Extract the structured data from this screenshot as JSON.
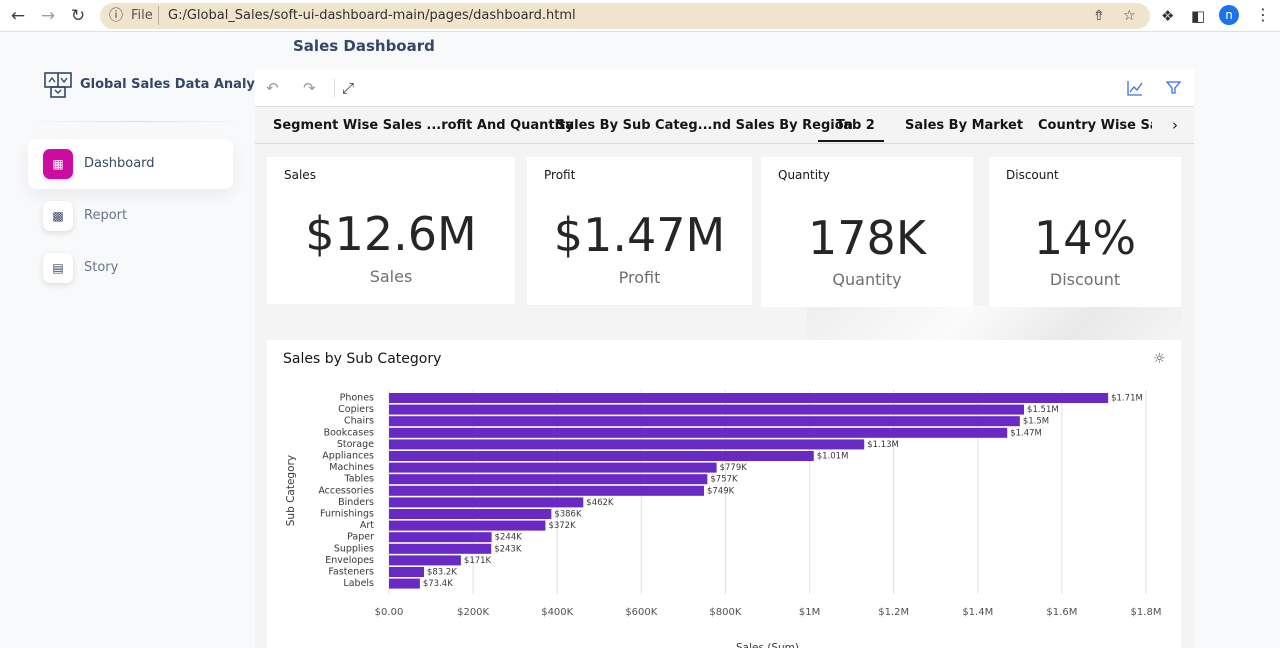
{
  "browser": {
    "back_icon": "arrow-left-icon",
    "forward_icon": "arrow-right-icon",
    "reload_icon": "reload-icon",
    "info_icon": "info-icon",
    "scheme_label": "File",
    "url": "G:/Global_Sales/soft-ui-dashboard-main/pages/dashboard.html",
    "share_icon": "share-icon",
    "bookmark_icon": "star-icon",
    "extensions_icon": "puzzle-icon",
    "sidepanel_icon": "side-panel-icon",
    "profile_initial": "n",
    "menu_icon": "kebab-menu-icon"
  },
  "page": {
    "title": "Sales Dashboard"
  },
  "sidebar": {
    "brand": "Global Sales Data Analytics",
    "items": [
      {
        "label": "Dashboard",
        "icon": "shop-icon",
        "active": true
      },
      {
        "label": "Report",
        "icon": "bar-chart-icon",
        "active": false
      },
      {
        "label": "Story",
        "icon": "card-icon",
        "active": false
      }
    ]
  },
  "toolbar": {
    "undo_icon": "undo-icon",
    "redo_icon": "redo-icon",
    "fullscreen_icon": "expand-icon",
    "chart_icon": "line-chart-icon",
    "filter_icon": "filter-icon"
  },
  "tabs": [
    {
      "label": "Segment Wise Sales ...rofit And Quantity",
      "active": false
    },
    {
      "label": "Sales By Sub Categ...nd Sales By Region",
      "active": false
    },
    {
      "label": "Tab 2",
      "active": true
    },
    {
      "label": "Sales By Market",
      "active": false
    },
    {
      "label": "Country Wise Sales U",
      "active": false
    }
  ],
  "kpis": [
    {
      "label": "Sales",
      "value": "$12.6M",
      "caption": "Sales"
    },
    {
      "label": "Profit",
      "value": "$1.47M",
      "caption": "Profit"
    },
    {
      "label": "Quantity",
      "value": "178K",
      "caption": "Quantity"
    },
    {
      "label": "Discount",
      "value": "14%",
      "caption": "Discount"
    }
  ],
  "chart_card": {
    "title": "Sales by Sub Category",
    "insight_icon": "lightbulb-icon"
  },
  "colors": {
    "bar": "#6929c4",
    "accent": "#cb0c9f",
    "brand_text": "#344767"
  },
  "chart_data": {
    "type": "bar",
    "orientation": "horizontal",
    "title": "Sales by Sub Category",
    "xlabel": "Sales (Sum)",
    "ylabel": "Sub Category",
    "xlim": [
      0,
      1800000
    ],
    "xticks": [
      {
        "value": 0,
        "label": "$0.00"
      },
      {
        "value": 200000,
        "label": "$200K"
      },
      {
        "value": 400000,
        "label": "$400K"
      },
      {
        "value": 600000,
        "label": "$600K"
      },
      {
        "value": 800000,
        "label": "$800K"
      },
      {
        "value": 1000000,
        "label": "$1M"
      },
      {
        "value": 1200000,
        "label": "$1.2M"
      },
      {
        "value": 1400000,
        "label": "$1.4M"
      },
      {
        "value": 1600000,
        "label": "$1.6M"
      },
      {
        "value": 1800000,
        "label": "$1.8M"
      }
    ],
    "grid": true,
    "categories": [
      "Phones",
      "Copiers",
      "Chairs",
      "Bookcases",
      "Storage",
      "Appliances",
      "Machines",
      "Tables",
      "Accessories",
      "Binders",
      "Furnishings",
      "Art",
      "Paper",
      "Supplies",
      "Envelopes",
      "Fasteners",
      "Labels"
    ],
    "values": [
      1710000,
      1510000,
      1500000,
      1470000,
      1130000,
      1010000,
      779000,
      757000,
      749000,
      462000,
      386000,
      372000,
      244000,
      243000,
      171000,
      83200,
      73400
    ],
    "data_labels": [
      "$1.71M",
      "$1.51M",
      "$1.5M",
      "$1.47M",
      "$1.13M",
      "$1.01M",
      "$779K",
      "$757K",
      "$749K",
      "$462K",
      "$386K",
      "$372K",
      "$244K",
      "$243K",
      "$171K",
      "$83.2K",
      "$73.4K"
    ]
  }
}
